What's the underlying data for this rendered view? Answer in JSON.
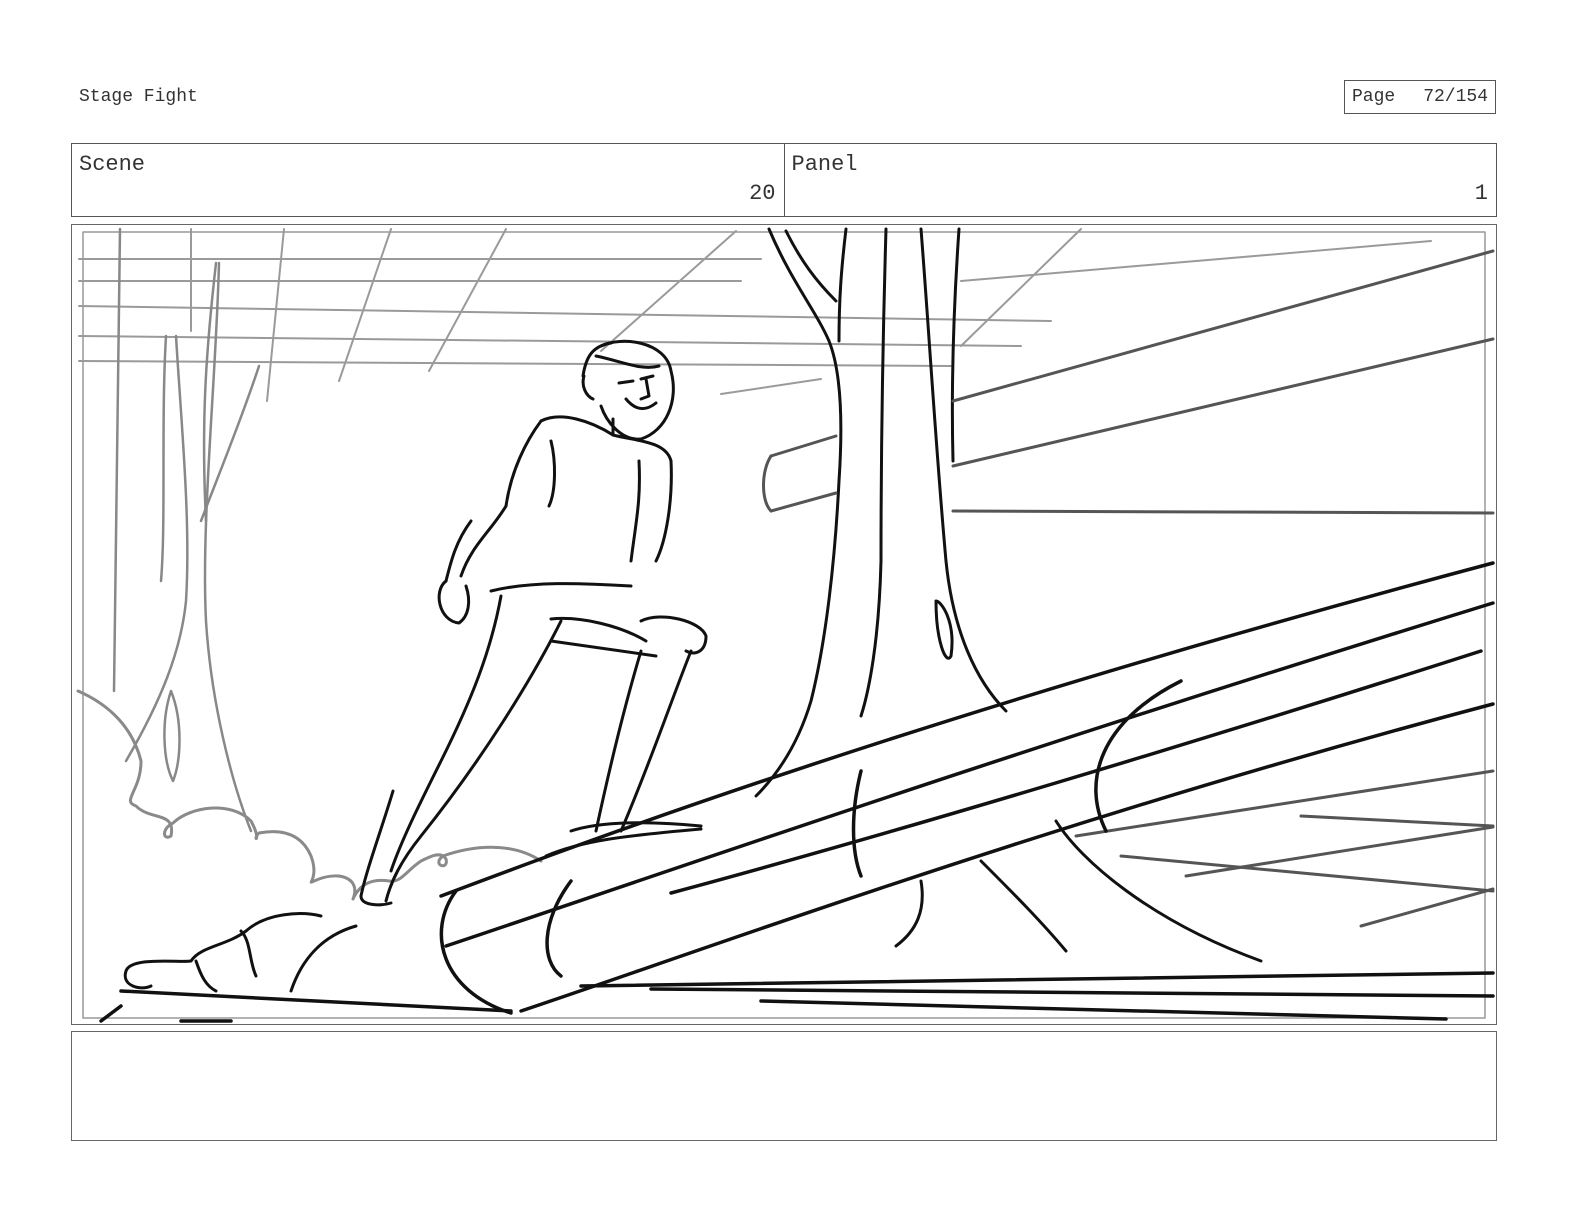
{
  "header": {
    "title": "Stage Fight",
    "page_label": "Page",
    "page_value": "72/154"
  },
  "scene": {
    "label": "Scene",
    "value": "20"
  },
  "panel": {
    "label": "Panel",
    "value": "1"
  },
  "notes": {
    "text": ""
  },
  "colors": {
    "ink": "#111111",
    "grey_ink": "#8a8a8a",
    "frame": "#555555"
  }
}
